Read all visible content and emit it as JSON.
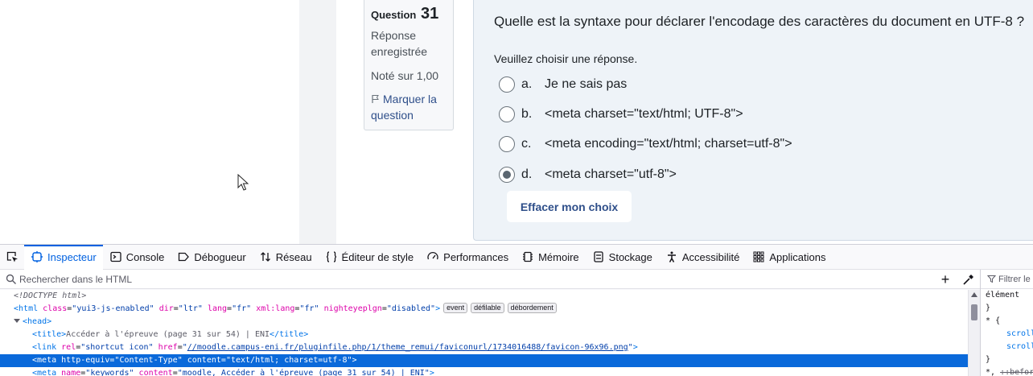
{
  "question_info": {
    "label": "Question",
    "number": "31",
    "state": "Réponse enregistrée",
    "grade": "Noté sur 1,00",
    "flag_label": "Marquer la question"
  },
  "question": {
    "text": "Quelle est la syntaxe pour déclarer l'encodage des caractères du document en UTF-8 ?",
    "prompt": "Veuillez choisir une réponse.",
    "answers": [
      {
        "letter": "a.",
        "text": "Je ne sais pas",
        "checked": false
      },
      {
        "letter": "b.",
        "text": "<meta charset=\"text/html; UTF-8\">",
        "checked": false
      },
      {
        "letter": "c.",
        "text": "<meta encoding=\"text/html; charset=utf-8\">",
        "checked": false
      },
      {
        "letter": "d.",
        "text": "<meta charset=\"utf-8\">",
        "checked": true
      }
    ],
    "clear_label": "Effacer mon choix"
  },
  "devtools": {
    "tabs": [
      {
        "label": "Inspecteur",
        "icon": "inspector-icon",
        "active": true
      },
      {
        "label": "Console",
        "icon": "console-icon",
        "active": false
      },
      {
        "label": "Débogueur",
        "icon": "debugger-icon",
        "active": false
      },
      {
        "label": "Réseau",
        "icon": "network-icon",
        "active": false
      },
      {
        "label": "Éditeur de style",
        "icon": "style-editor-icon",
        "active": false
      },
      {
        "label": "Performances",
        "icon": "performance-icon",
        "active": false
      },
      {
        "label": "Mémoire",
        "icon": "memory-icon",
        "active": false
      },
      {
        "label": "Stockage",
        "icon": "storage-icon",
        "active": false
      },
      {
        "label": "Accessibilité",
        "icon": "accessibility-icon",
        "active": false
      },
      {
        "label": "Applications",
        "icon": "applications-icon",
        "active": false
      }
    ],
    "search_placeholder": "Rechercher dans le HTML",
    "html_tree": {
      "doctype": "<!DOCTYPE html>",
      "html_open": {
        "tag": "html",
        "attrs": [
          {
            "name": "class",
            "value": "yui3-js-enabled"
          },
          {
            "name": "dir",
            "value": "ltr"
          },
          {
            "name": "lang",
            "value": "fr"
          },
          {
            "name": "xml:lang",
            "value": "fr"
          },
          {
            "name": "nighteyeplgn",
            "value": "disabled"
          }
        ],
        "badges": [
          "event",
          "défilable",
          "débordement"
        ]
      },
      "head_tag": "head",
      "title_line": {
        "tag": "title",
        "text": "Accéder à l'épreuve (page 31 sur 54) | ENI"
      },
      "link_line": {
        "tag": "link",
        "attrs": [
          {
            "name": "rel",
            "value": "shortcut icon"
          },
          {
            "name": "href",
            "value": "//moodle.campus-eni.fr/pluginfile.php/1/theme_remui/faviconurl/1734016488/favicon-96x96.png"
          }
        ]
      },
      "meta_selected": {
        "tag": "meta",
        "attrs": [
          {
            "name": "http-equiv",
            "value": "Content-Type"
          },
          {
            "name": "content",
            "value": "text/html; charset=utf-8"
          }
        ]
      },
      "meta_keywords": {
        "tag": "meta",
        "attrs": [
          {
            "name": "name",
            "value": "keywords"
          },
          {
            "name": "content",
            "value": "moodle, Accéder à l'épreuve (page 31 sur 54) | ENI"
          }
        ]
      }
    },
    "rules_panel": {
      "filter_placeholder": "Filtrer le",
      "element_label": "élément",
      "close_brace": "}",
      "universal_selector": "*",
      "open_brace": "{",
      "prop1": "scroll",
      "prop2": "scroll",
      "pseudo_line_prefix": "*,",
      "pseudo_line": "::befor"
    }
  }
}
